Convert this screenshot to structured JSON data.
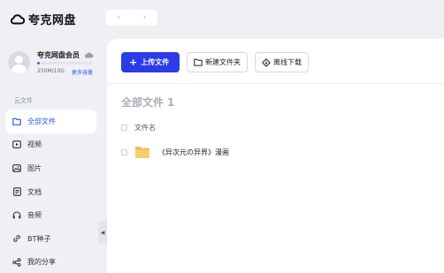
{
  "app": {
    "title": "夸克网盘"
  },
  "nav_buttons": {
    "back": "‹",
    "forward": "›"
  },
  "user": {
    "name": "夸克网盘会员",
    "quota_text": "250M/10G",
    "quota_used_fraction": 0.05,
    "more_capacity": "更多容量"
  },
  "sidebar": {
    "section_title": "云文件",
    "items": [
      {
        "label": "全部文件",
        "icon": "folder-icon",
        "active": true
      },
      {
        "label": "视频",
        "icon": "video-icon",
        "active": false
      },
      {
        "label": "图片",
        "icon": "image-icon",
        "active": false
      },
      {
        "label": "文档",
        "icon": "document-icon",
        "active": false
      },
      {
        "label": "音频",
        "icon": "headphones-icon",
        "active": false
      },
      {
        "label": "BT种子",
        "icon": "link-icon",
        "active": false
      },
      {
        "label": "我的分享",
        "icon": "share-icon",
        "active": false
      }
    ]
  },
  "toolbar": {
    "upload_label": "上传文件",
    "new_folder_label": "新建文件夹",
    "offline_download_label": "离线下载"
  },
  "main": {
    "title": "全部文件",
    "count": "1",
    "column_name": "文件名",
    "files": [
      {
        "name": "《异次元の异界》漫画",
        "type": "folder"
      }
    ]
  },
  "colors": {
    "accent": "#2b3be8",
    "active_text": "#2d56f3",
    "folder": "#f7c56b",
    "background": "#eef0f4"
  }
}
